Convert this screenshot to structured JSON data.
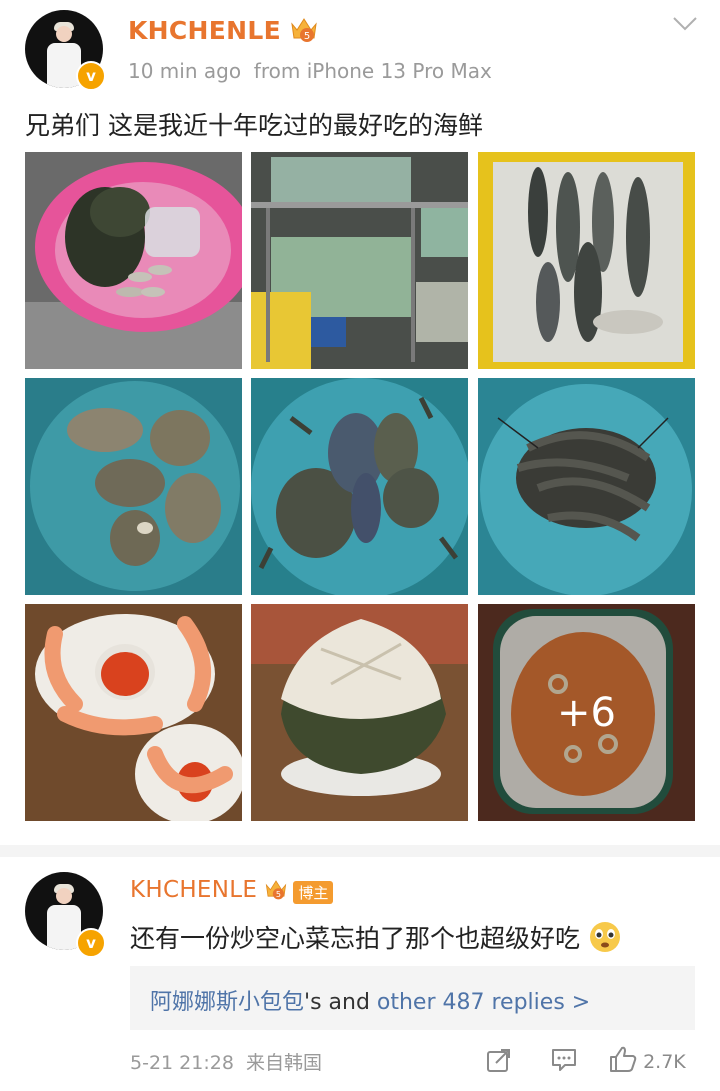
{
  "post": {
    "username": "KHCHENLE",
    "level": "5",
    "time": "10 min ago",
    "source": "from iPhone 13 Pro Max",
    "text": "兄弟们 这是我近十年吃过的最好吃的海鲜",
    "more_photos": "+6"
  },
  "comment": {
    "username": "KHCHENLE",
    "level": "5",
    "badge": "博主",
    "text": "还有一份炒空心菜忘拍了那个也超级好吃",
    "emoji": "worried-face",
    "reply_user": "阿娜娜斯小包包",
    "reply_mid": "'s and ",
    "reply_link": "other 487 replies >",
    "date": "5-21 21:28",
    "location": "来自韩国",
    "likes": "2.7K"
  },
  "colors": {
    "username": "#e8752e",
    "link": "#4f74a8",
    "meta": "#9a9a9a"
  }
}
